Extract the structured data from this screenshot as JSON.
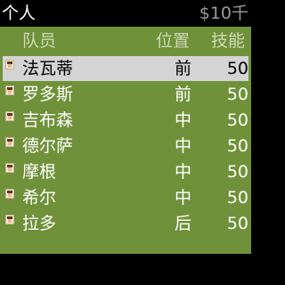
{
  "header": {
    "title": "个人",
    "budget": "$10千"
  },
  "table": {
    "columns": {
      "name": "队员",
      "position": "位置",
      "skill": "技能"
    },
    "rows": [
      {
        "name": "法瓦蒂",
        "position": "前",
        "skill": "50",
        "selected": true
      },
      {
        "name": "罗多斯",
        "position": "前",
        "skill": "50",
        "selected": false
      },
      {
        "name": "吉布森",
        "position": "中",
        "skill": "50",
        "selected": false
      },
      {
        "name": "德尔萨",
        "position": "中",
        "skill": "50",
        "selected": false
      },
      {
        "name": "摩根",
        "position": "中",
        "skill": "50",
        "selected": false
      },
      {
        "name": "希尔",
        "position": "中",
        "skill": "50",
        "selected": false
      },
      {
        "name": "拉多",
        "position": "后",
        "skill": "50",
        "selected": false
      }
    ]
  },
  "colors": {
    "panel": "#6f9139",
    "selected_row": "#d4d4d4",
    "header_text": "#cfd8b6"
  }
}
